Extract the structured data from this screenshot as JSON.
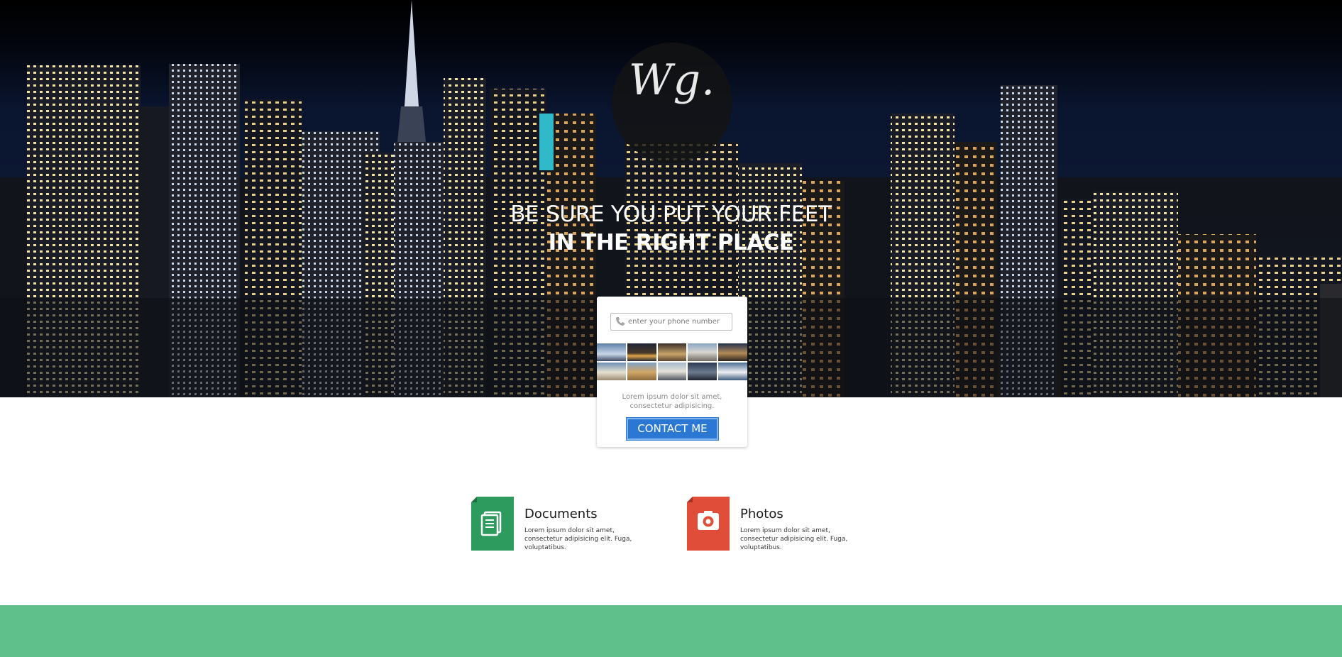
{
  "hero": {
    "logo_text": "Wg.",
    "headline_line1": "BE SURE YOU PUT YOUR FEET",
    "headline_line2": "IN THE RIGHT PLACE"
  },
  "signup_card": {
    "phone_placeholder": "enter your phone number",
    "phone_icon": "phone-icon",
    "thumbnail_icons": [
      "opera-house-photo",
      "eiffel-tower-photo",
      "pyramids-photo",
      "cathedral-photo",
      "colosseum-photo",
      "leaning-tower-photo",
      "sphinx-photo",
      "arch-photo",
      "tower-photo",
      "taj-mahal-photo"
    ],
    "description": "Lorem ipsum dolor sit amet, consectetur adipisicing.",
    "button_label": "CONTACT ME",
    "button_color": "#2b78d4"
  },
  "features": [
    {
      "title": "Documents",
      "description": "Lorem ipsum dolor sit amet, consectetur adipisicing elit. Fuga, voluptatibus.",
      "icon": "documents-icon",
      "color": "#2e9b5e"
    },
    {
      "title": "Photos",
      "description": "Lorem ipsum dolor sit amet, consectetur adipisicing elit. Fuga, voluptatibus.",
      "icon": "camera-icon",
      "color": "#e04e3a"
    }
  ],
  "footer_band": {
    "color": "#60c08b"
  }
}
